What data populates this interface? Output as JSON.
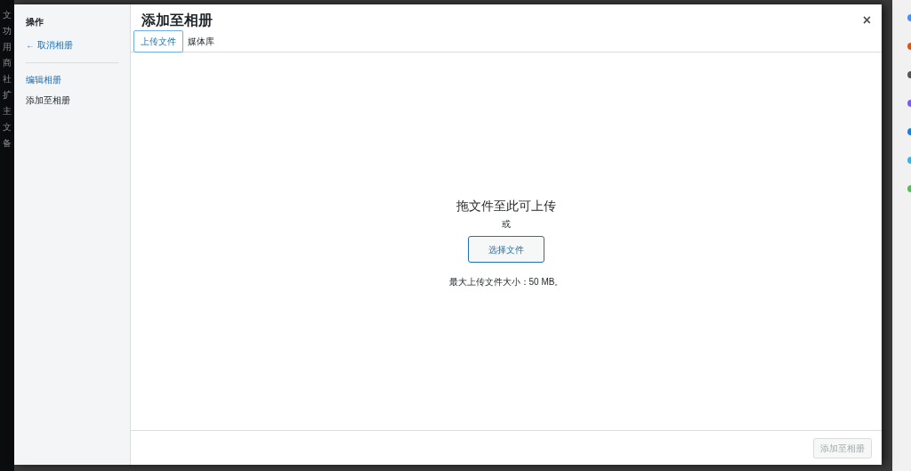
{
  "admin_menu": [
    "文",
    "功",
    "用",
    "商",
    "社",
    "扩",
    "主",
    "文",
    "备"
  ],
  "modal": {
    "sidebar": {
      "heading": "操作",
      "cancel_link": "← 取消相册",
      "items": [
        {
          "label": "编辑相册",
          "selected": false
        },
        {
          "label": "添加至相册",
          "selected": true
        }
      ]
    },
    "title": "添加至相册",
    "close": "×",
    "tabs": [
      {
        "label": "上传文件",
        "selected": true
      },
      {
        "label": "媒体库",
        "selected": false
      }
    ],
    "uploader": {
      "instructions": "拖文件至此可上传",
      "or": "或",
      "button": "选择文件",
      "max_size": "最大上传文件大小：50 MB。"
    },
    "footer": {
      "button": {
        "label": "添加至相册",
        "disabled": true
      }
    }
  }
}
